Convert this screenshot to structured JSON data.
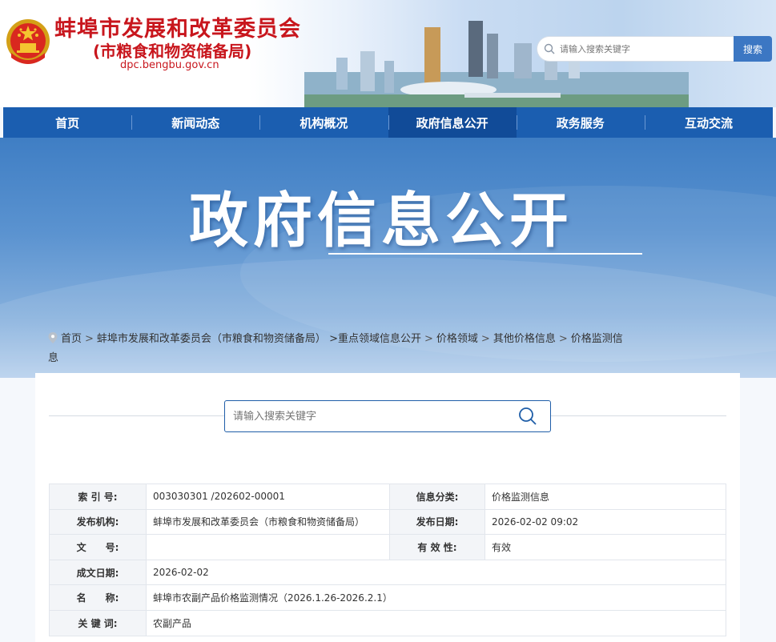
{
  "header": {
    "site_title": "蚌埠市发展和改革委员会",
    "site_subtitle": "(市粮食和物资储备局)",
    "site_domain": "dpc.bengbu.gov.cn",
    "search_placeholder": "请输入搜索关键字",
    "search_button": "搜索"
  },
  "nav": {
    "items": [
      "首页",
      "新闻动态",
      "机构概况",
      "政府信息公开",
      "政务服务",
      "互动交流"
    ],
    "active_index": 3
  },
  "banner": {
    "title": "政府信息公开"
  },
  "breadcrumb": {
    "items": [
      "首页",
      "蚌埠市发展和改革委员会（市粮食和物资储备局）",
      ">重点领域信息公开",
      "价格领域",
      "其他价格信息",
      "价格监测信息"
    ],
    "separator": ">"
  },
  "content_search": {
    "placeholder": "请输入搜索关键字"
  },
  "info": {
    "rows": [
      {
        "label": "索 引 号:",
        "value": "003030301 /202602-00001",
        "label2": "信息分类:",
        "value2": "价格监测信息"
      },
      {
        "label": "发布机构:",
        "value": "蚌埠市发展和改革委员会（市粮食和物资储备局）",
        "label2": "发布日期:",
        "value2": "2026-02-02 09:02"
      },
      {
        "label": "文　　号:",
        "value": "",
        "label2": "有 效 性:",
        "value2": "有效"
      },
      {
        "label": "成文日期:",
        "value": "2026-02-02"
      },
      {
        "label": "名　　称:",
        "value": "蚌埠市农副产品价格监测情况（2026.1.26-2026.2.1）"
      },
      {
        "label": "关 键 词:",
        "value": "农副产品"
      }
    ]
  },
  "colors": {
    "brand_red": "#c8161d",
    "nav_blue": "#1b5eb0",
    "nav_active": "#114b98",
    "search_button": "#3c77c3"
  }
}
